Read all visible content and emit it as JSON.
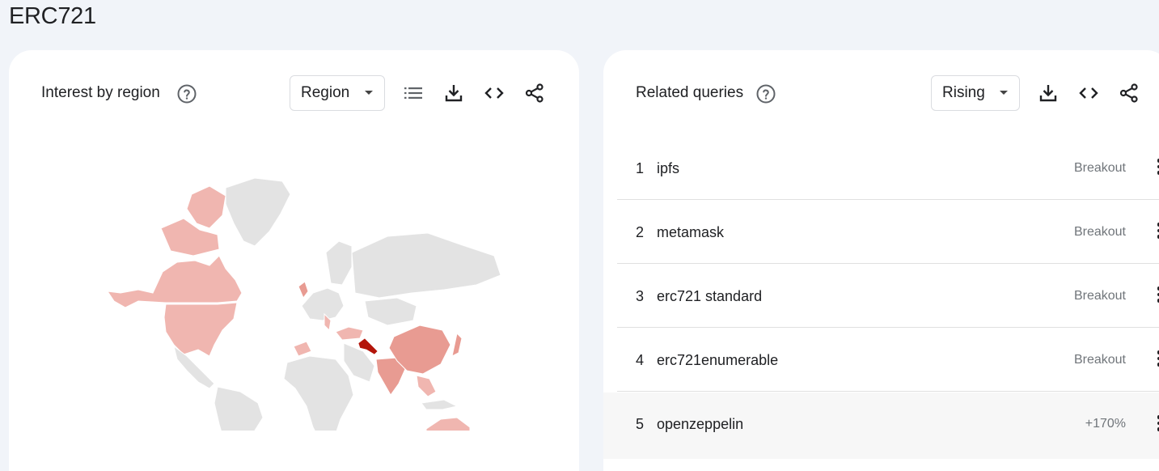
{
  "page": {
    "title": "ERC721"
  },
  "region_card": {
    "title": "Interest by region",
    "help_icon": "help-circle-icon",
    "resolution_dropdown": {
      "selected": "Region"
    },
    "tools": [
      "list-icon",
      "download-icon",
      "embed-code-icon",
      "share-icon"
    ],
    "map": {
      "colors": {
        "no_data": "#e3e3e3",
        "low": "#f0b6b0",
        "medium": "#e89b92",
        "high": "#b3150a"
      }
    }
  },
  "queries_card": {
    "title": "Related queries",
    "help_icon": "help-circle-icon",
    "mode_dropdown": {
      "selected": "Rising"
    },
    "tools": [
      "download-icon",
      "embed-code-icon",
      "share-icon"
    ],
    "rows": [
      {
        "rank": "1",
        "query": "ipfs",
        "value": "Breakout"
      },
      {
        "rank": "2",
        "query": "metamask",
        "value": "Breakout"
      },
      {
        "rank": "3",
        "query": "erc721 standard",
        "value": "Breakout"
      },
      {
        "rank": "4",
        "query": "erc721enumerable",
        "value": "Breakout"
      },
      {
        "rank": "5",
        "query": "openzeppelin",
        "value": "+170%"
      }
    ]
  }
}
